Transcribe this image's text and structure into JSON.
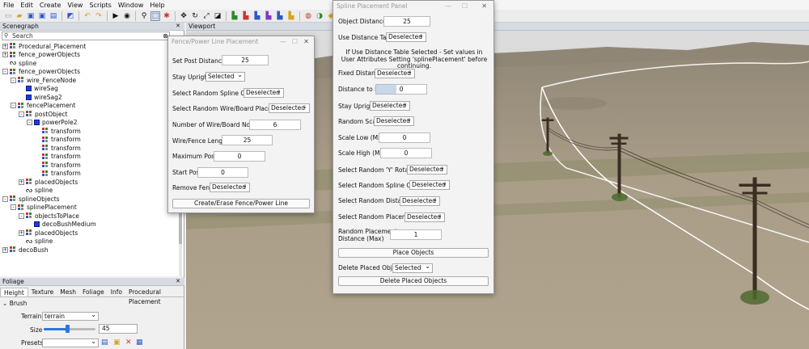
{
  "menu": [
    "File",
    "Edit",
    "Create",
    "View",
    "Scripts",
    "Window",
    "Help"
  ],
  "scenegraph": {
    "title": "Scenegraph",
    "search_placeholder": "Search",
    "tree": [
      {
        "label": "Procedural_Placement",
        "type": "group",
        "depth": 0,
        "exp": "+"
      },
      {
        "label": "fence_powerObjects",
        "type": "group",
        "depth": 0,
        "exp": "+"
      },
      {
        "label": "spline",
        "type": "spline",
        "depth": 0,
        "exp": ""
      },
      {
        "label": "fence_powerObjects",
        "type": "group",
        "depth": 0,
        "exp": "-"
      },
      {
        "label": "wire_FenceNode",
        "type": "group",
        "depth": 1,
        "exp": "-"
      },
      {
        "label": "wireSag",
        "type": "cube",
        "depth": 2,
        "exp": ""
      },
      {
        "label": "wireSag2",
        "type": "cube",
        "depth": 2,
        "exp": ""
      },
      {
        "label": "fencePlacement",
        "type": "group",
        "depth": 1,
        "exp": "-"
      },
      {
        "label": "postObject",
        "type": "group",
        "depth": 2,
        "exp": "-"
      },
      {
        "label": "powerPole2",
        "type": "cube",
        "depth": 3,
        "exp": "-"
      },
      {
        "label": "transform",
        "type": "group",
        "depth": 4,
        "exp": ""
      },
      {
        "label": "transform",
        "type": "group",
        "depth": 4,
        "exp": ""
      },
      {
        "label": "transform",
        "type": "group",
        "depth": 4,
        "exp": ""
      },
      {
        "label": "transform",
        "type": "group",
        "depth": 4,
        "exp": ""
      },
      {
        "label": "transform",
        "type": "group",
        "depth": 4,
        "exp": ""
      },
      {
        "label": "transform",
        "type": "group",
        "depth": 4,
        "exp": ""
      },
      {
        "label": "placedObjects",
        "type": "group",
        "depth": 2,
        "exp": "+"
      },
      {
        "label": "spline",
        "type": "spline",
        "depth": 2,
        "exp": ""
      },
      {
        "label": "splineObjects",
        "type": "group",
        "depth": 0,
        "exp": "-"
      },
      {
        "label": "splinePlacement",
        "type": "group",
        "depth": 1,
        "exp": "-"
      },
      {
        "label": "objectsToPlace",
        "type": "group",
        "depth": 2,
        "exp": "-"
      },
      {
        "label": "decoBushMedium",
        "type": "cube",
        "depth": 3,
        "exp": ""
      },
      {
        "label": "placedObjects",
        "type": "group",
        "depth": 2,
        "exp": "+"
      },
      {
        "label": "spline",
        "type": "spline",
        "depth": 2,
        "exp": ""
      },
      {
        "label": "decoBush",
        "type": "group",
        "depth": 0,
        "exp": "+"
      }
    ]
  },
  "foliage": {
    "title": "Foliage",
    "tabs": [
      "Height",
      "Texture",
      "Mesh",
      "Foliage",
      "Info",
      "Procedural Placement"
    ],
    "brush_label": "Brush",
    "terrain_label": "Terrain",
    "terrain_value": "terrain",
    "size_label": "Size",
    "size_value": "45",
    "size_level": 0.45,
    "presets_label": "Presets"
  },
  "viewport": {
    "title": "Viewport"
  },
  "fence_dialog": {
    "title": "Fence/Power Line Placement",
    "set_post_distance_label": "Set Post Distance",
    "set_post_distance": "25",
    "stay_upright_label": "Stay Upright",
    "stay_upright": "Selected",
    "random_spline_order_label": "Select Random Spline Order",
    "random_spline_order": "Deselected",
    "random_wire_label": "Select Random Wire/Board Placement",
    "random_wire": "Deselected",
    "num_nodes_label": "Number of Wire/Board Nodes",
    "num_nodes": "6",
    "wire_length_label": "Wire/Fence Length",
    "wire_length": "25",
    "max_posts_label": "Maximum Posts",
    "max_posts": "0",
    "start_post_label": "Start Post",
    "start_post": "0",
    "remove_fence_label": "Remove Fence",
    "remove_fence": "Deselected",
    "create_button": "Create/Erase Fence/Power Line"
  },
  "spline_dialog": {
    "title": "Spline Placement Panel",
    "object_distance_label": "Object Distance",
    "object_distance": "25",
    "use_distance_table_label": "Use Distance Table",
    "use_distance_table": "Deselected",
    "note_line1": "If Use Distance Table Selected - Set values in",
    "note_line2": "User Attributes Setting 'splinePlacement' before continuing.",
    "fixed_distance_label": "Fixed Distance",
    "fixed_distance": "Deselected",
    "distance_to_fix_label": "Distance to Fix",
    "distance_to_fix": "0",
    "stay_upright_label": "Stay Upright",
    "stay_upright": "Deselected",
    "random_scale_label": "Random Scale",
    "random_scale": "Deselected",
    "scale_low_label": "Scale Low (Min)",
    "scale_low": "0",
    "scale_high_label": "Scale High (Max)",
    "scale_high": "0",
    "random_y_rotation_label": "Select Random 'Y' Rotation",
    "random_y_rotation": "Deselected",
    "random_spline_order_label": "Select Random Spline Order",
    "random_spline_order": "Deselected",
    "random_distance_label": "Select Random Distance",
    "random_distance": "Deselected",
    "random_placement_label": "Select Random Placement",
    "random_placement": "Deselected",
    "random_placement_distance_label_1": "Random Placement",
    "random_placement_distance_label_2": "Distance (Max)",
    "random_placement_distance": "1",
    "place_button": "Place Objects",
    "delete_placed_label": "Delete Placed Objects",
    "delete_placed": "Selected",
    "delete_button": "Delete Placed Objects"
  },
  "colors": {
    "accent": "#1f3bd8",
    "terrain": "#a59a86",
    "sky": "#d9d9d9"
  }
}
